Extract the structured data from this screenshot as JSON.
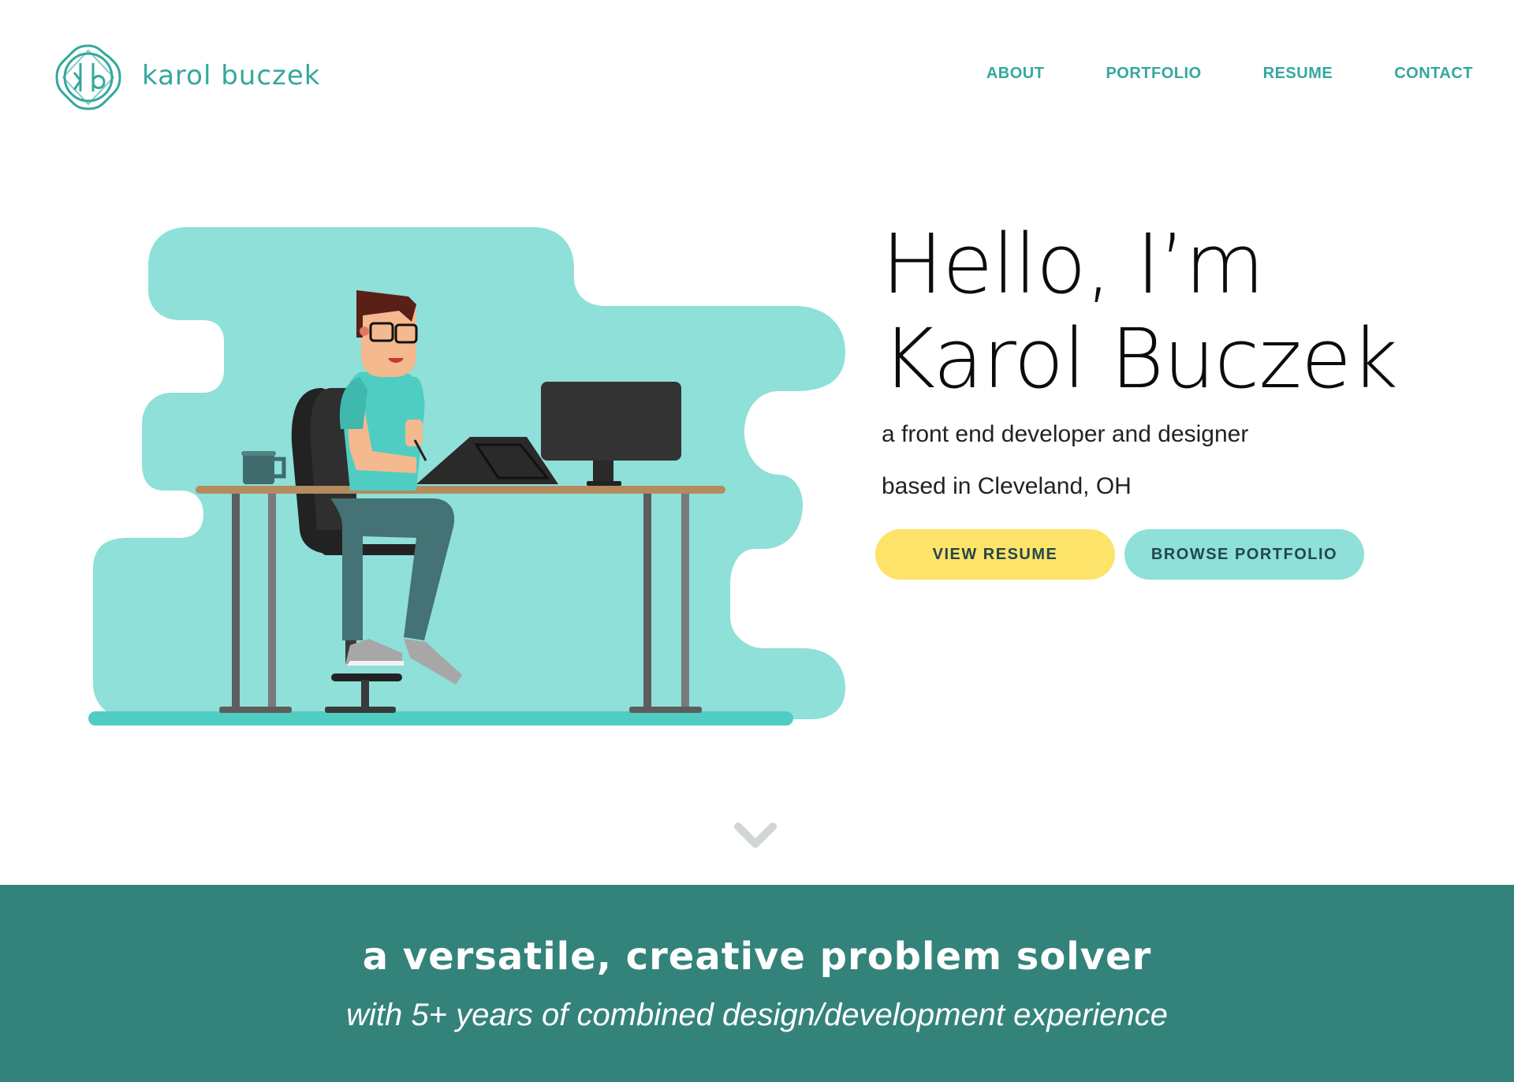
{
  "brand": {
    "monogram": "kb",
    "name": "karol buczek",
    "accent_color": "#34a89c"
  },
  "nav": {
    "items": [
      {
        "label": "ABOUT"
      },
      {
        "label": "PORTFOLIO"
      },
      {
        "label": "RESUME"
      },
      {
        "label": "CONTACT"
      }
    ]
  },
  "hero": {
    "title_line1": "Hello, I’m",
    "title_line2": "Karol Buczek",
    "subtitle_line1": "a front end developer and designer",
    "subtitle_line2": "based in Cleveland, OH",
    "buttons": {
      "resume_label": "VIEW RESUME",
      "portfolio_label": "BROWSE PORTFOLIO"
    },
    "colors": {
      "resume_button": "#fde36a",
      "portfolio_button": "#8ee0d9",
      "blob": "#8ee0d9"
    }
  },
  "scroll_indicator": {
    "icon": "chevron-down-icon"
  },
  "band": {
    "title": "a versatile, creative problem solver",
    "subtitle": "with 5+ years of combined design/development experience",
    "background": "#33837b"
  }
}
